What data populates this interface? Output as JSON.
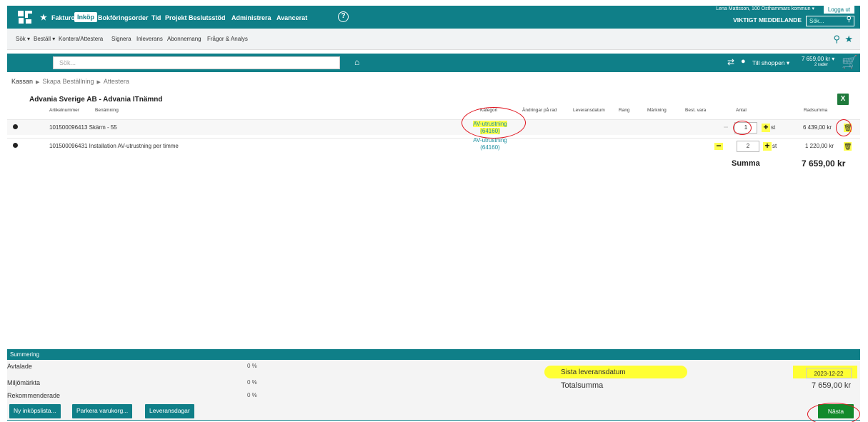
{
  "header": {
    "nav": [
      "Fakturor",
      "Inköp",
      "Bokföringsorder",
      "Tid",
      "Projekt",
      "Beslutsstöd",
      "Administrera",
      "Avancerat"
    ],
    "active_nav": "Inköp",
    "help": "?",
    "user": "Lena Mattsson, 100 Östhammars kommun ▾",
    "logout": "Logga ut",
    "important": "VIKTIGT MEDDELANDE",
    "search_placeholder": "Sök..."
  },
  "subnav": {
    "items": [
      "Sök ▾",
      "Beställ ▾",
      "Kontera/Attestera",
      "Signera",
      "Inleverans",
      "Abonnemang",
      "Frågor & Analys"
    ]
  },
  "searchbar": {
    "placeholder": "Sök...",
    "shop": "Till shoppen ▾",
    "cart_total": "7 659,00 kr ▾",
    "cart_rows": "2 rader"
  },
  "breadcrumb": {
    "first": "Kassan",
    "second": "Skapa Beställning",
    "third": "Attestera"
  },
  "order": {
    "supplier": "Advania Sverige AB - Advania ITnämnd",
    "columns": {
      "artnr": "Artikelnummer",
      "name": "Benämning",
      "category": "Kategori",
      "changes": "Ändringar på rad",
      "delivery": "Leveransdatum",
      "rank": "Rang",
      "marking": "Märkning",
      "order_item": "Best. vara",
      "qty": "Antal",
      "rowsum": "Radsumma"
    },
    "rows": [
      {
        "artnr_name": "101500096413 Skärm - 55",
        "category": "AV-utrustning",
        "category_code": "(64160)",
        "qty": "1",
        "unit": "st",
        "rowsum": "6 439,00 kr"
      },
      {
        "artnr_name": "101500096431 Installation AV-utrustning per timme",
        "category": "AV-utrustning",
        "category_code": "(64160)",
        "qty": "2",
        "unit": "st",
        "rowsum": "1 220,00 kr"
      }
    ],
    "summa_label": "Summa",
    "summa_value": "7 659,00 kr"
  },
  "summary": {
    "title": "Summering",
    "rows": [
      {
        "label": "Avtalade",
        "pct": "0 %"
      },
      {
        "label": "Miljömärkta",
        "pct": "0 %"
      },
      {
        "label": "Rekommenderade",
        "pct": "0 %"
      }
    ],
    "last_delivery_label": "Sista leveransdatum",
    "last_delivery_date": "2023-12-22",
    "total_label": "Totalsumma",
    "total_value": "7 659,00 kr",
    "buttons": [
      "Ny inköpslista...",
      "Parkera varukorg...",
      "Leveransdagar"
    ],
    "next": "Nästa"
  },
  "colors": {
    "brand": "#0f7f88",
    "next_button": "#128a2b",
    "highlight": "#ffff33",
    "annotation": "#e0141e"
  }
}
